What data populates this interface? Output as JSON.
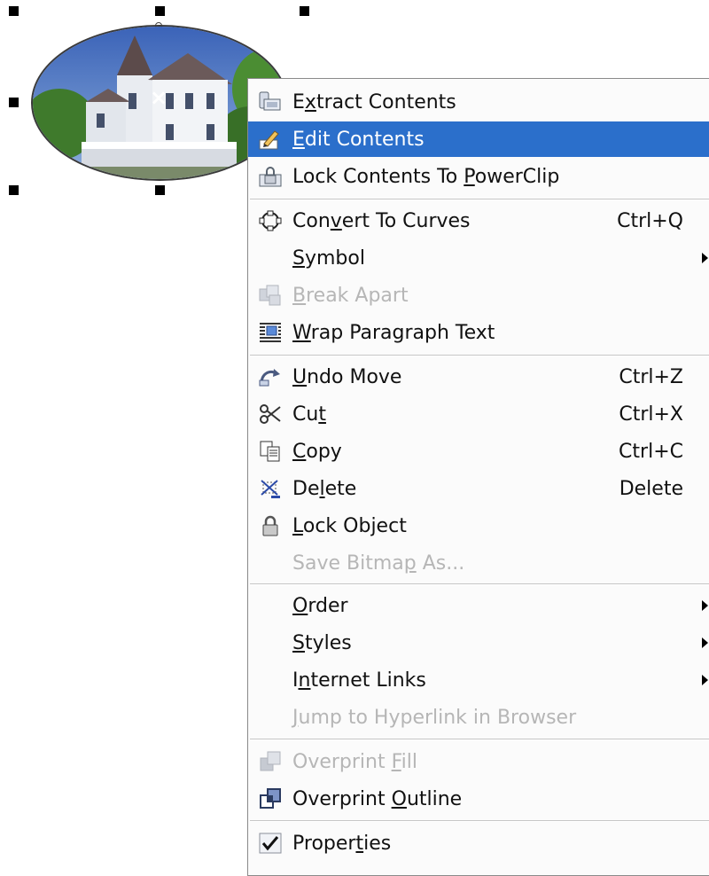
{
  "canvas": {
    "object_type": "PowerClip ellipse with photo",
    "icons": {
      "center_marker": "x-marker-icon"
    }
  },
  "context_menu": {
    "highlight_color": "#2b6fcb",
    "disabled_text_color": "#b6b6b6",
    "items": [
      {
        "name": "extract-contents",
        "icon": "extract-contents-icon",
        "label_pre": "E",
        "label_ul": "x",
        "label_post": "tract Contents",
        "shortcut": "",
        "submenu": false,
        "enabled": true,
        "highlighted": false
      },
      {
        "name": "edit-contents",
        "icon": "edit-contents-icon",
        "label_pre": "",
        "label_ul": "E",
        "label_post": "dit Contents",
        "shortcut": "",
        "submenu": false,
        "enabled": true,
        "highlighted": true
      },
      {
        "name": "lock-contents-to-powerclip",
        "icon": "lock-contents-icon",
        "label_pre": "Lock Contents To ",
        "label_ul": "P",
        "label_post": "owerClip",
        "shortcut": "",
        "submenu": false,
        "enabled": true,
        "highlighted": false
      },
      {
        "name": "convert-to-curves",
        "icon": "convert-curves-icon",
        "label_pre": "Con",
        "label_ul": "v",
        "label_post": "ert To Curves",
        "shortcut": "Ctrl+Q",
        "submenu": false,
        "enabled": true,
        "highlighted": false
      },
      {
        "name": "symbol",
        "icon": "",
        "label_pre": "",
        "label_ul": "S",
        "label_post": "ymbol",
        "shortcut": "",
        "submenu": true,
        "enabled": true,
        "highlighted": false
      },
      {
        "name": "break-apart",
        "icon": "break-apart-icon",
        "label_pre": "",
        "label_ul": "B",
        "label_post": "reak  Apart",
        "shortcut": "",
        "submenu": false,
        "enabled": false,
        "highlighted": false
      },
      {
        "name": "wrap-paragraph-text",
        "icon": "wrap-text-icon",
        "label_pre": "",
        "label_ul": "W",
        "label_post": "rap Paragraph Text",
        "shortcut": "",
        "submenu": false,
        "enabled": true,
        "highlighted": false
      },
      {
        "name": "undo-move",
        "icon": "undo-icon",
        "label_pre": "",
        "label_ul": "U",
        "label_post": "ndo Move",
        "shortcut": "Ctrl+Z",
        "submenu": false,
        "enabled": true,
        "highlighted": false
      },
      {
        "name": "cut",
        "icon": "scissors-icon",
        "label_pre": "Cu",
        "label_ul": "t",
        "label_post": "",
        "shortcut": "Ctrl+X",
        "submenu": false,
        "enabled": true,
        "highlighted": false
      },
      {
        "name": "copy",
        "icon": "copy-icon",
        "label_pre": "",
        "label_ul": "C",
        "label_post": "opy",
        "shortcut": "Ctrl+C",
        "submenu": false,
        "enabled": true,
        "highlighted": false
      },
      {
        "name": "delete",
        "icon": "delete-icon",
        "label_pre": "De",
        "label_ul": "l",
        "label_post": "ete",
        "shortcut": "Delete",
        "submenu": false,
        "enabled": true,
        "highlighted": false
      },
      {
        "name": "lock-object",
        "icon": "padlock-icon",
        "label_pre": "",
        "label_ul": "L",
        "label_post": "ock Object",
        "shortcut": "",
        "submenu": false,
        "enabled": true,
        "highlighted": false
      },
      {
        "name": "save-bitmap-as",
        "icon": "",
        "label_pre": "Save Bitma",
        "label_ul": "p",
        "label_post": " As...",
        "shortcut": "",
        "submenu": false,
        "enabled": false,
        "highlighted": false
      },
      {
        "name": "order",
        "icon": "",
        "label_pre": "",
        "label_ul": "O",
        "label_post": "rder",
        "shortcut": "",
        "submenu": true,
        "enabled": true,
        "highlighted": false
      },
      {
        "name": "styles",
        "icon": "",
        "label_pre": "",
        "label_ul": "S",
        "label_post": "tyles",
        "shortcut": "",
        "submenu": true,
        "enabled": true,
        "highlighted": false
      },
      {
        "name": "internet-links",
        "icon": "",
        "label_pre": "I",
        "label_ul": "n",
        "label_post": "ternet Links",
        "shortcut": "",
        "submenu": true,
        "enabled": true,
        "highlighted": false
      },
      {
        "name": "jump-to-hyperlink",
        "icon": "",
        "label_pre": "",
        "label_ul": "J",
        "label_post": "ump to Hyperlink in Browser",
        "shortcut": "",
        "submenu": false,
        "enabled": false,
        "highlighted": false
      },
      {
        "name": "overprint-fill",
        "icon": "overprint-fill-icon",
        "label_pre": "Overprint ",
        "label_ul": "F",
        "label_post": "ill",
        "shortcut": "",
        "submenu": false,
        "enabled": false,
        "highlighted": false
      },
      {
        "name": "overprint-outline",
        "icon": "overprint-outline-icon",
        "label_pre": "Overprint ",
        "label_ul": "O",
        "label_post": "utline",
        "shortcut": "",
        "submenu": false,
        "enabled": true,
        "highlighted": false
      },
      {
        "name": "properties",
        "icon": "checkmark-icon",
        "label_pre": "Proper",
        "label_ul": "t",
        "label_post": "ies",
        "shortcut": "",
        "submenu": false,
        "enabled": true,
        "highlighted": false
      }
    ]
  }
}
